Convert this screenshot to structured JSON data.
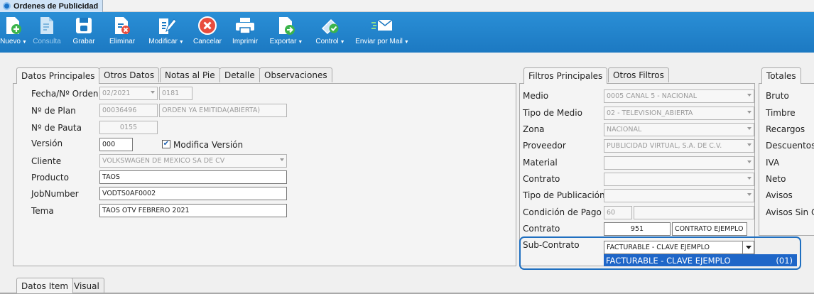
{
  "window": {
    "tab_title": "Ordenes de Publicidad"
  },
  "toolbar": {
    "nuevo": "Nuevo",
    "consulta": "Consulta",
    "grabar": "Grabar",
    "eliminar": "Eliminar",
    "modificar": "Modificar",
    "cancelar": "Cancelar",
    "imprimir": "Imprimir",
    "exportar": "Exportar",
    "control": "Control",
    "enviar_mail": "Enviar por Mail"
  },
  "main_tabs": [
    "Datos Principales",
    "Otros Datos",
    "Notas al Pie",
    "Detalle",
    "Observaciones"
  ],
  "main": {
    "fecha_label": "Fecha/Nº Orden",
    "fecha_value": "02/2021",
    "orden_value": "0181",
    "plan_label": "Nº de Plan",
    "plan_value": "00036496",
    "plan_status": "ORDEN YA EMITIDA(ABIERTA)",
    "pauta_label": "Nº de Pauta",
    "pauta_value": "0155",
    "version_label": "Versión",
    "version_value": "000",
    "modifica_version_label": "Modifica Versión",
    "modifica_version_checked": true,
    "cliente_label": "Cliente",
    "cliente_value": "VOLKSWAGEN DE MEXICO SA DE CV",
    "producto_label": "Producto",
    "producto_value": "TAOS",
    "jobnumber_label": "JobNumber",
    "jobnumber_value": "VODTS0AF0002",
    "tema_label": "Tema",
    "tema_value": "TAOS OTV FEBRERO 2021"
  },
  "filter_tabs": [
    "Filtros Principales",
    "Otros Filtros"
  ],
  "filters": {
    "medio_label": "Medio",
    "medio_value": "0005 CANAL 5 - NACIONAL",
    "tipo_medio_label": "Tipo de Medio",
    "tipo_medio_value": "02 - TELEVISION_ABIERTA",
    "zona_label": "Zona",
    "zona_value": "NACIONAL",
    "proveedor_label": "Proveedor",
    "proveedor_value": "PUBLICIDAD VIRTUAL, S.A. DE C.V.",
    "material_label": "Material",
    "material_value": "",
    "contrato_label": "Contrato",
    "contrato_value": "",
    "tipo_publicacion_label": "Tipo de Publicación",
    "tipo_publicacion_value": "",
    "condicion_pago_label": "Condición de Pago",
    "condicion_pago_value": "60",
    "contrato2_label": "Contrato",
    "contrato2_number": "951",
    "contrato2_name": "CONTRATO EJEMPLO",
    "subcontrato_label": "Sub-Contrato",
    "subcontrato_value": "FACTURABLE - CLAVE EJEMPLO",
    "subcontrato_option_name": "FACTURABLE - CLAVE EJEMPLO",
    "subcontrato_option_code": "(01)"
  },
  "totals_tab": "Totales",
  "totals": [
    "Bruto",
    "Timbre",
    "Recargos",
    "Descuentos",
    "IVA",
    "Neto",
    "Avisos",
    "Avisos Sin C"
  ],
  "bottom_tabs": [
    "Datos Item",
    "Visual"
  ],
  "colors": {
    "toolbar": "#1c79c2",
    "highlight": "#1f6fc0",
    "selection": "#1e66c8"
  }
}
